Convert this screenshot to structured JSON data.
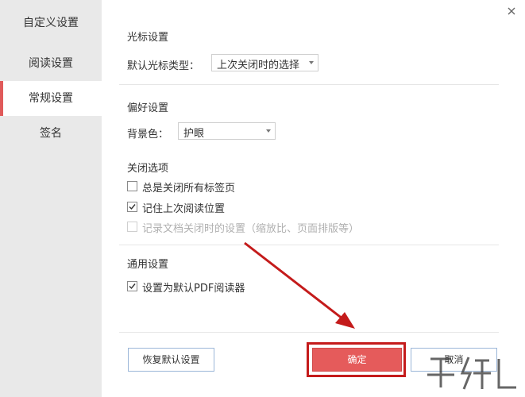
{
  "sidebar": {
    "title": "自定义设置",
    "items": [
      {
        "label": "阅读设置"
      },
      {
        "label": "常规设置"
      },
      {
        "label": "签名"
      }
    ]
  },
  "cursor_section": {
    "title": "光标设置",
    "label": "默认光标类型：",
    "selected": "上次关闭时的选择"
  },
  "preference_section": {
    "title": "偏好设置",
    "label": "背景色：",
    "selected": "护眼"
  },
  "close_section": {
    "title": "关闭选项",
    "options": [
      {
        "label": "总是关闭所有标签页",
        "checked": false,
        "enabled": true
      },
      {
        "label": "记住上次阅读位置",
        "checked": true,
        "enabled": true
      },
      {
        "label": "记录文档关闭时的设置（缩放比、页面排版等）",
        "checked": false,
        "enabled": false
      }
    ]
  },
  "general_section": {
    "title": "通用设置",
    "options": [
      {
        "label": "设置为默认PDF阅读器",
        "checked": true,
        "enabled": true
      }
    ]
  },
  "buttons": {
    "reset": "恢复默认设置",
    "ok": "确定",
    "cancel": "取消"
  },
  "colors": {
    "accent": "#e05a5a",
    "ok_button": "#e55b5b",
    "annotation": "#c41b1b",
    "sidebar_bg": "#e9e9e9"
  }
}
